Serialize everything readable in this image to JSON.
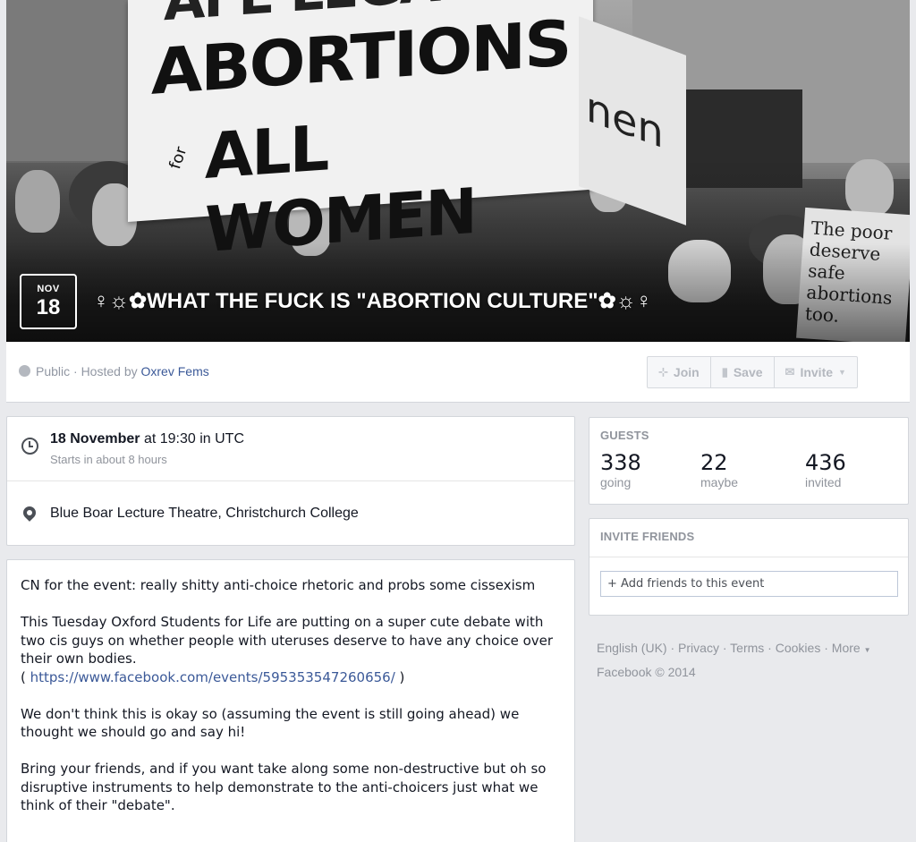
{
  "cover": {
    "month": "NOV",
    "day": "18",
    "title": "♀☼✿WHAT THE FUCK IS \"ABORTION CULTURE\"✿☼♀",
    "banner_line0": "AFE LEGA",
    "banner_line1": "ABORTIONS",
    "banner_for": "for",
    "banner_line2": "ALL WOMEN",
    "banner2_text": "nen",
    "sign_text": "The poor deserve safe abortions too."
  },
  "header": {
    "privacy": "Public · Hosted by ",
    "host": "Oxrev Fems",
    "join": "Join",
    "save": "Save",
    "invite": "Invite"
  },
  "details": {
    "date_bold": "18 November",
    "time": " at 19:30 in UTC",
    "relative": "Starts in about 8 hours",
    "location": "Blue Boar Lecture Theatre, Christchurch College"
  },
  "description": {
    "p1": "CN for the event: really shitty anti-choice rhetoric and probs some cissexism",
    "p2": "This Tuesday Oxford Students for Life are putting on a super cute debate with two cis guys on whether people with uteruses deserve to have any choice over their own bodies.",
    "link_open": "( ",
    "link": "https://www.facebook.com/events/595353547260656/",
    "link_close": " )",
    "p3": "We don't think this is okay so (assuming the event is still going ahead) we thought we should go and say hi!",
    "p4": "Bring your friends, and if you want take along some non-destructive but oh so disruptive instruments to help demonstrate to the anti-choicers just what we think of their \"debate\"."
  },
  "guests": {
    "title": "GUESTS",
    "going_count": "338",
    "going_label": "going",
    "maybe_count": "22",
    "maybe_label": "maybe",
    "invited_count": "436",
    "invited_label": "invited"
  },
  "invite_friends": {
    "title": "INVITE FRIENDS",
    "placeholder": "+ Add friends to this event"
  },
  "footer": {
    "english": "English (UK)",
    "privacy": "Privacy",
    "terms": "Terms",
    "cookies": "Cookies",
    "more": "More",
    "copyright": "Facebook © 2014"
  }
}
